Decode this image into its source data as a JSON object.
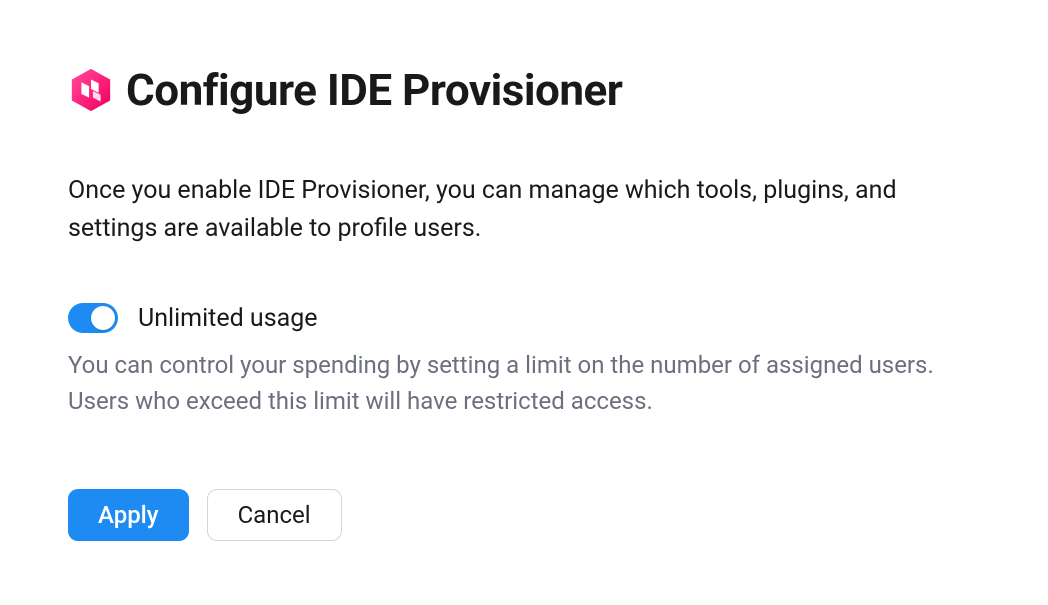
{
  "header": {
    "title": "Configure IDE Provisioner",
    "icon": "toolbox-icon"
  },
  "description": "Once you enable IDE Provisioner, you can manage which tools, plugins, and settings are available to profile users.",
  "toggle": {
    "label": "Unlimited usage",
    "enabled": true,
    "help": "You can control your spending by setting a limit on the number of assigned users. Users who exceed this limit will have restricted access."
  },
  "buttons": {
    "apply": "Apply",
    "cancel": "Cancel"
  },
  "colors": {
    "accent": "#1d8bf2",
    "iconGradientStart": "#ff1f7a",
    "iconGradientEnd": "#e3005b"
  }
}
